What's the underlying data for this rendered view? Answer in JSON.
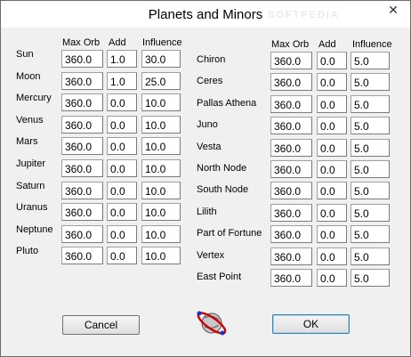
{
  "window": {
    "title": "Planets and Minors"
  },
  "watermark": "SOFTPEDIA",
  "headers": {
    "max_orb": "Max Orb",
    "add": "Add",
    "influence": "Influence"
  },
  "left": [
    {
      "label": "Sun",
      "orb": "360.0",
      "add": "1.0",
      "inf": "30.0"
    },
    {
      "label": "Moon",
      "orb": "360.0",
      "add": "1.0",
      "inf": "25.0"
    },
    {
      "label": "Mercury",
      "orb": "360.0",
      "add": "0.0",
      "inf": "10.0"
    },
    {
      "label": "Venus",
      "orb": "360.0",
      "add": "0.0",
      "inf": "10.0"
    },
    {
      "label": "Mars",
      "orb": "360.0",
      "add": "0.0",
      "inf": "10.0"
    },
    {
      "label": "Jupiter",
      "orb": "360.0",
      "add": "0.0",
      "inf": "10.0"
    },
    {
      "label": "Saturn",
      "orb": "360.0",
      "add": "0.0",
      "inf": "10.0"
    },
    {
      "label": "Uranus",
      "orb": "360.0",
      "add": "0.0",
      "inf": "10.0"
    },
    {
      "label": "Neptune",
      "orb": "360.0",
      "add": "0.0",
      "inf": "10.0"
    },
    {
      "label": "Pluto",
      "orb": "360.0",
      "add": "0.0",
      "inf": "10.0"
    }
  ],
  "right": [
    {
      "label": "Chiron",
      "orb": "360.0",
      "add": "0.0",
      "inf": "5.0"
    },
    {
      "label": "Ceres",
      "orb": "360.0",
      "add": "0.0",
      "inf": "5.0"
    },
    {
      "label": "Pallas Athena",
      "orb": "360.0",
      "add": "0.0",
      "inf": "5.0"
    },
    {
      "label": "Juno",
      "orb": "360.0",
      "add": "0.0",
      "inf": "5.0"
    },
    {
      "label": "Vesta",
      "orb": "360.0",
      "add": "0.0",
      "inf": "5.0"
    },
    {
      "label": "North Node",
      "orb": "360.0",
      "add": "0.0",
      "inf": "5.0"
    },
    {
      "label": "South Node",
      "orb": "360.0",
      "add": "0.0",
      "inf": "5.0"
    },
    {
      "label": "Lilith",
      "orb": "360.0",
      "add": "0.0",
      "inf": "5.0"
    },
    {
      "label": "Part of Fortune",
      "orb": "360.0",
      "add": "0.0",
      "inf": "5.0"
    },
    {
      "label": "Vertex",
      "orb": "360.0",
      "add": "0.0",
      "inf": "5.0"
    },
    {
      "label": "East Point",
      "orb": "360.0",
      "add": "0.0",
      "inf": "5.0"
    }
  ],
  "buttons": {
    "cancel": "Cancel",
    "ok": "OK"
  },
  "icons": {
    "close": "close-icon",
    "planet": "planet-icon"
  }
}
